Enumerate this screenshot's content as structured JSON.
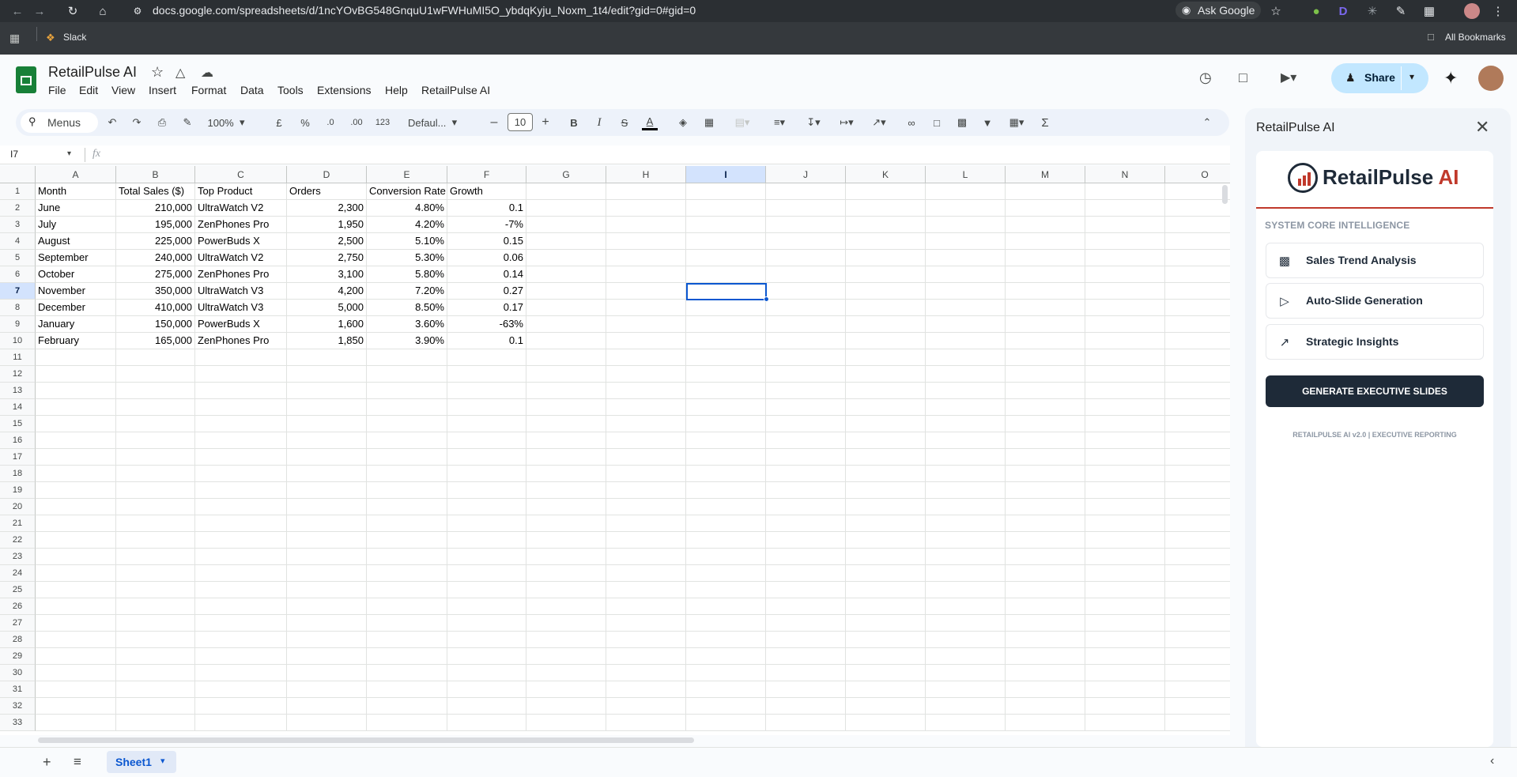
{
  "browser": {
    "url": "docs.google.com/spreadsheets/d/1ncYOvBG548GnquU1wFWHuMI5O_ybdqKyju_Noxm_1t4/edit?gid=0#gid=0",
    "ask_google": "Ask Google",
    "bookmark_slack": "Slack",
    "all_bookmarks": "All Bookmarks"
  },
  "app": {
    "title": "RetailPulse AI",
    "menus": [
      "File",
      "Edit",
      "View",
      "Insert",
      "Format",
      "Data",
      "Tools",
      "Extensions",
      "Help",
      "RetailPulse AI"
    ],
    "share_label": "Share"
  },
  "toolbar": {
    "search_label": "Menus",
    "zoom": "100%",
    "currency": "£",
    "percent": "%",
    "dec_decrease": ".0",
    "dec_increase": ".00",
    "number_format": "123",
    "font": "Defaul...",
    "font_size": "10",
    "bold": "B",
    "italic": "I",
    "strike": "S",
    "text_color": "A"
  },
  "formula_bar": {
    "cell_ref": "I7",
    "fx": "fx",
    "value": ""
  },
  "grid": {
    "columns": [
      "A",
      "B",
      "C",
      "D",
      "E",
      "F",
      "G",
      "H",
      "I",
      "J",
      "K",
      "L",
      "M",
      "N",
      "O"
    ],
    "row_numbers": [
      "1",
      "2",
      "3",
      "4",
      "5",
      "6",
      "7",
      "8",
      "9",
      "10",
      "11",
      "12",
      "13",
      "14",
      "15",
      "16",
      "17",
      "18",
      "19",
      "20",
      "21",
      "22",
      "23",
      "24",
      "25",
      "26",
      "27",
      "28",
      "29",
      "30",
      "31",
      "32",
      "33"
    ],
    "headers": [
      "Month",
      "Total Sales ($)",
      "Top Product",
      "Orders",
      "Conversion Rate",
      "Growth"
    ],
    "rows": [
      [
        "June",
        "210,000",
        "UltraWatch V2",
        "2,300",
        "4.80%",
        "0.1"
      ],
      [
        "July",
        "195,000",
        "ZenPhones Pro",
        "1,950",
        "4.20%",
        "-7%"
      ],
      [
        "August",
        "225,000",
        "PowerBuds X",
        "2,500",
        "5.10%",
        "0.15"
      ],
      [
        "September",
        "240,000",
        "UltraWatch V2",
        "2,750",
        "5.30%",
        "0.06"
      ],
      [
        "October",
        "275,000",
        "ZenPhones Pro",
        "3,100",
        "5.80%",
        "0.14"
      ],
      [
        "November",
        "350,000",
        "UltraWatch V3",
        "4,200",
        "7.20%",
        "0.27"
      ],
      [
        "December",
        "410,000",
        "UltraWatch V3",
        "5,000",
        "8.50%",
        "0.17"
      ],
      [
        "January",
        "150,000",
        "PowerBuds X",
        "1,600",
        "3.60%",
        "-63%"
      ],
      [
        "February",
        "165,000",
        "ZenPhones Pro",
        "1,850",
        "3.90%",
        "0.1"
      ]
    ],
    "selected_cell": "I7"
  },
  "sheets": {
    "active": "Sheet1"
  },
  "panel": {
    "title": "RetailPulse AI",
    "logo_text_a": "RetailPulse",
    "logo_text_b": "AI",
    "section_label": "SYSTEM CORE INTELLIGENCE",
    "features": [
      "Sales Trend Analysis",
      "Auto-Slide Generation",
      "Strategic Insights"
    ],
    "generate_button": "GENERATE EXECUTIVE SLIDES",
    "footer": "RETAILPULSE AI v2.0 | EXECUTIVE REPORTING"
  },
  "colors": {
    "accent": "#0b57d0",
    "brand_red": "#c0392b",
    "brand_navy": "#1e2a38",
    "sheets_green": "#188038"
  }
}
